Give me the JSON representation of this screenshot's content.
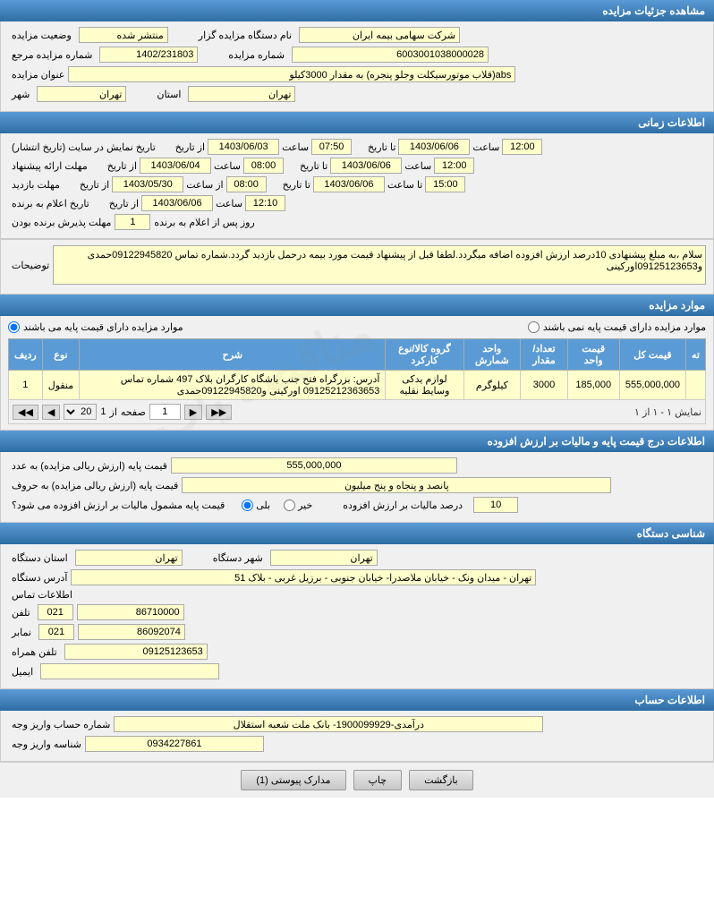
{
  "page": {
    "title": "مشاهده جزئیات مزایده"
  },
  "main_info": {
    "header": "مشاهده جزئیات مزایده",
    "fields": {
      "agency_name_label": "نام دستگاه مزایده گزار",
      "agency_name_value": "شرکت سهامی بیمه ایران",
      "status_label": "وضعیت مزایده",
      "status_value": "منتشر شده",
      "mazayede_number_label": "شماره مزایده",
      "mazayede_number_value": "6003001038000028",
      "ref_number_label": "شماره مزایده مرجع",
      "ref_number_value": "1402/231803",
      "title_label": "عنوان مزایده",
      "title_value": "abs(قلاب موتورسیکلت وجلو پنجره) به مقدار 3000کیلو",
      "province_label": "استان",
      "province_value": "تهران",
      "city_label": "شهر",
      "city_value": "تهران"
    }
  },
  "time_info": {
    "header": "اطلاعات زمانی",
    "rows": [
      {
        "label": "تاریخ نمایش در سایت (تاریخ انتشار)",
        "from_date": "1403/06/03",
        "from_time": "07:50",
        "to_date": "1403/06/06",
        "to_time": "12:00"
      },
      {
        "label": "مهلت ارائه پیشنهاد",
        "from_date": "1403/06/04",
        "from_time": "08:00",
        "to_date": "1403/06/06",
        "to_time": "12:00"
      },
      {
        "label": "مهلت بازدید",
        "from_date": "1403/05/30",
        "from_time": "08:00",
        "to_date": "1403/06/06",
        "to_time": "15:00"
      },
      {
        "label": "تاریخ اعلام به برنده",
        "from_date": "1403/06/06",
        "from_time": "12:10",
        "to_date": "",
        "to_time": ""
      }
    ],
    "winner_days_label": "مهلت پذیرش برنده بودن",
    "winner_days_value": "1",
    "winner_days_suffix": "روز پس از اعلام به برنده"
  },
  "notes": {
    "label": "توضیحات",
    "value": "سلام ،به مبلغ پیشنهادی 10درصد ارزش افزوده اضافه میگردد.لطفا قبل از پیشنهاد قیمت مورد بیمه درحمل بازدید گردد.شماره تماس 09122945820حمدی و09125123653اورکینی"
  },
  "moarad": {
    "header": "موارد مزایده",
    "option1_label": "موارد مزایده دارای قیمت پایه می باشند",
    "option2_label": "موارد مزایده دارای قیمت پایه نمی باشند",
    "table": {
      "columns": [
        "ردیف",
        "نوع",
        "شرح",
        "گروه کالا/نوع کارکرد",
        "واحد شمارش",
        "تعداد/مقدار",
        "قیمت واحد",
        "قیمت کل",
        "ته"
      ],
      "rows": [
        {
          "row": "1",
          "type": "منقول",
          "description": "آدرس: بزرگراه فتح جنب باشگاه کارگران بلاک 497 شماره تماس 09125212363653 اورکینی و09122945820حمدی",
          "category": "لوازم یدکی وسایط نقلیه",
          "unit": "کیلوگرم",
          "quantity": "3000",
          "unit_price": "185,000",
          "total_price": "555,000,000",
          "extra": ""
        }
      ]
    },
    "pagination": {
      "showing": "نمایش ۱ - ۱ از ۱",
      "page_label": "صفحه",
      "page_num": "1",
      "of_label": "از",
      "total_pages": "1",
      "per_page": "20"
    }
  },
  "price_tax": {
    "header": "اطلاعات درج قیمت پایه و مالیات بر ارزش افزوده",
    "base_price_label": "قیمت پایه (ارزش ریالی مزایده) به عدد",
    "base_price_value": "555,000,000",
    "base_price_text_label": "قیمت پایه (ارزش ریالی مزایده) به حروف",
    "base_price_text_value": "پانصد و پنجاه و پنج میلیون",
    "tax_included_label": "قیمت پایه مشمول مالیات بر ارزش افزوده می شود؟",
    "tax_yes": "بلی",
    "tax_no": "خیر",
    "tax_selected": "no",
    "tax_rate_label": "درصد مالیات بر ارزش افزوده",
    "tax_rate_value": "10"
  },
  "agency_info": {
    "header": "شناسی دستگاه",
    "province_label": "استان دستگاه",
    "province_value": "تهران",
    "city_label": "شهر دستگاه",
    "city_value": "تهران",
    "address_label": "آدرس دستگاه",
    "address_value": "تهران - میدان ونک - خیابان ملاصدرا- خیابان جنوبی - برزیل غربی - بلاک 51",
    "contact_header": "اطلاعات تماس",
    "phone_label": "تلفن",
    "phone_code": "021",
    "phone_value": "86710000",
    "fax_label": "نمابر",
    "fax_code": "021",
    "fax_value": "86092074",
    "mobile_label": "تلفن همراه",
    "mobile_value": "09125123653",
    "email_label": "ایمیل",
    "email_value": ""
  },
  "account_info": {
    "header": "اطلاعات حساب",
    "account_label": "شماره حساب واریز وجه",
    "account_value": "درآمدی-1900099929- بانک ملت شعبه استقلال",
    "shenas_label": "شناسه واریز وجه",
    "shenas_value": "0934227861"
  },
  "buttons": {
    "documents": "مدارک پیوستی (1)",
    "print": "چاپ",
    "back": "بازگشت"
  }
}
